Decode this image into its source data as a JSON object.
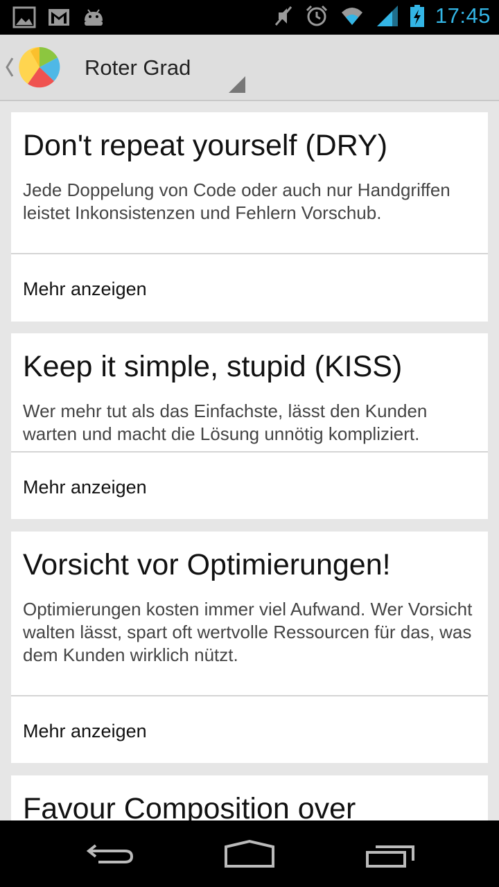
{
  "status_bar": {
    "time": "17:45",
    "left_icons": [
      "gallery-notification-icon",
      "gmail-notification-icon",
      "android-notification-icon"
    ],
    "right_icons": [
      "mute-icon",
      "alarm-icon",
      "wifi-icon",
      "signal-icon",
      "battery-charging-icon"
    ],
    "accent_color": "#33b5e5"
  },
  "action_bar": {
    "title": "Roter Grad",
    "logo": "app-logo-icon"
  },
  "cards": [
    {
      "title": "Don't repeat yourself (DRY)",
      "text": "Jede Doppelung von Code oder auch nur Handgriffen leistet Inkonsistenzen und Fehlern Vorschub.",
      "more": "Mehr anzeigen"
    },
    {
      "title": "Keep it simple, stupid (KISS)",
      "text": "Wer mehr tut als das Einfachste, lässt den Kunden warten und macht die Lösung unnötig kompliziert.",
      "more": "Mehr anzeigen"
    },
    {
      "title": "Vorsicht vor Optimierungen!",
      "text": "Optimierungen kosten immer viel Aufwand. Wer Vorsicht walten lässt, spart oft wertvolle Ressourcen für das, was dem Kunden wirklich nützt.",
      "more": "Mehr anzeigen"
    },
    {
      "title": "Favour Composition over"
    }
  ],
  "nav_bar": {
    "buttons": [
      "back-icon",
      "home-icon",
      "recent-apps-icon"
    ]
  }
}
